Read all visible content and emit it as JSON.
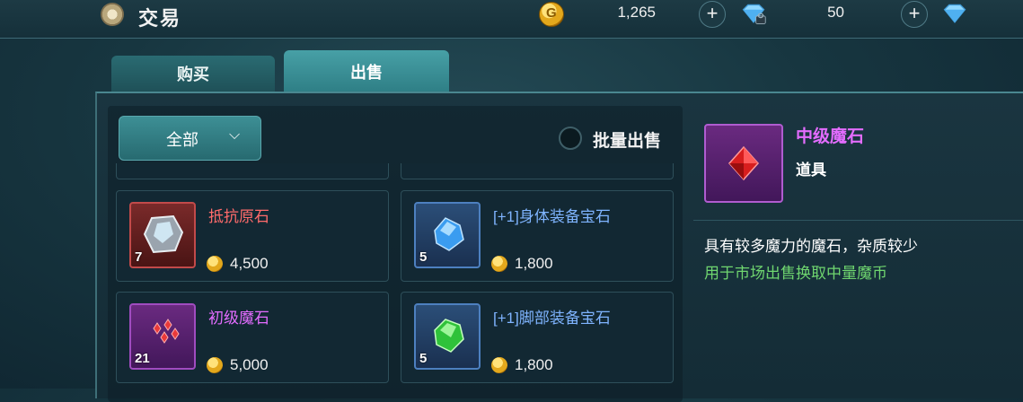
{
  "header": {
    "title": "交易",
    "gold": "1,265",
    "diamond_bound": "50",
    "plus_label": "+"
  },
  "tabs": [
    {
      "label": "购买",
      "active": false
    },
    {
      "label": "出售",
      "active": true
    }
  ],
  "filter": {
    "selected": "全部"
  },
  "bulk_sell": {
    "label": "批量出售",
    "checked": false
  },
  "items": [
    {
      "name": "抵抗原石",
      "count": "7",
      "price": "4,500",
      "name_color": "#ff6b6b",
      "rarity": "red",
      "icon": "gray-ore-icon"
    },
    {
      "name": "[+1]身体装备宝石",
      "count": "5",
      "price": "1,800",
      "name_color": "#7fb4ff",
      "rarity": "blue",
      "icon": "blue-gem-icon"
    },
    {
      "name": "初级魔石",
      "count": "21",
      "price": "5,000",
      "name_color": "#e36cff",
      "rarity": "purple",
      "icon": "red-shards-icon"
    },
    {
      "name": "[+1]脚部装备宝石",
      "count": "5",
      "price": "1,800",
      "name_color": "#7fb4ff",
      "rarity": "blue",
      "icon": "green-gem-icon"
    }
  ],
  "detail": {
    "name": "中级魔石",
    "type": "道具",
    "description": "具有较多魔力的魔石，杂质较少",
    "usage": "用于市场出售换取中量魔币",
    "icon": "red-crystal-icon"
  }
}
